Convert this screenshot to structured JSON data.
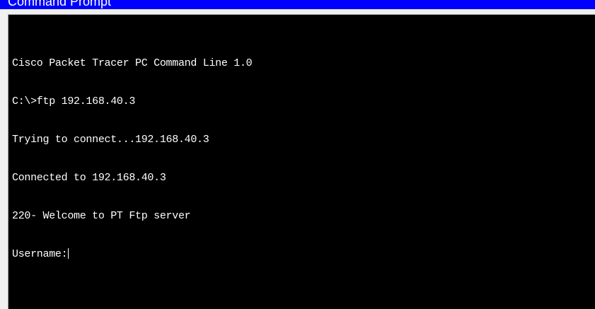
{
  "window": {
    "title": "Command Prompt",
    "title_bar_color": "#0000ff",
    "background_color": "#000000",
    "text_color": "#ffffff"
  },
  "terminal": {
    "lines": [
      "Cisco Packet Tracer PC Command Line 1.0",
      "C:\\>ftp 192.168.40.3",
      "Trying to connect...192.168.40.3",
      "Connected to 192.168.40.3",
      "220- Welcome to PT Ftp server"
    ],
    "prompt": "Username:"
  }
}
